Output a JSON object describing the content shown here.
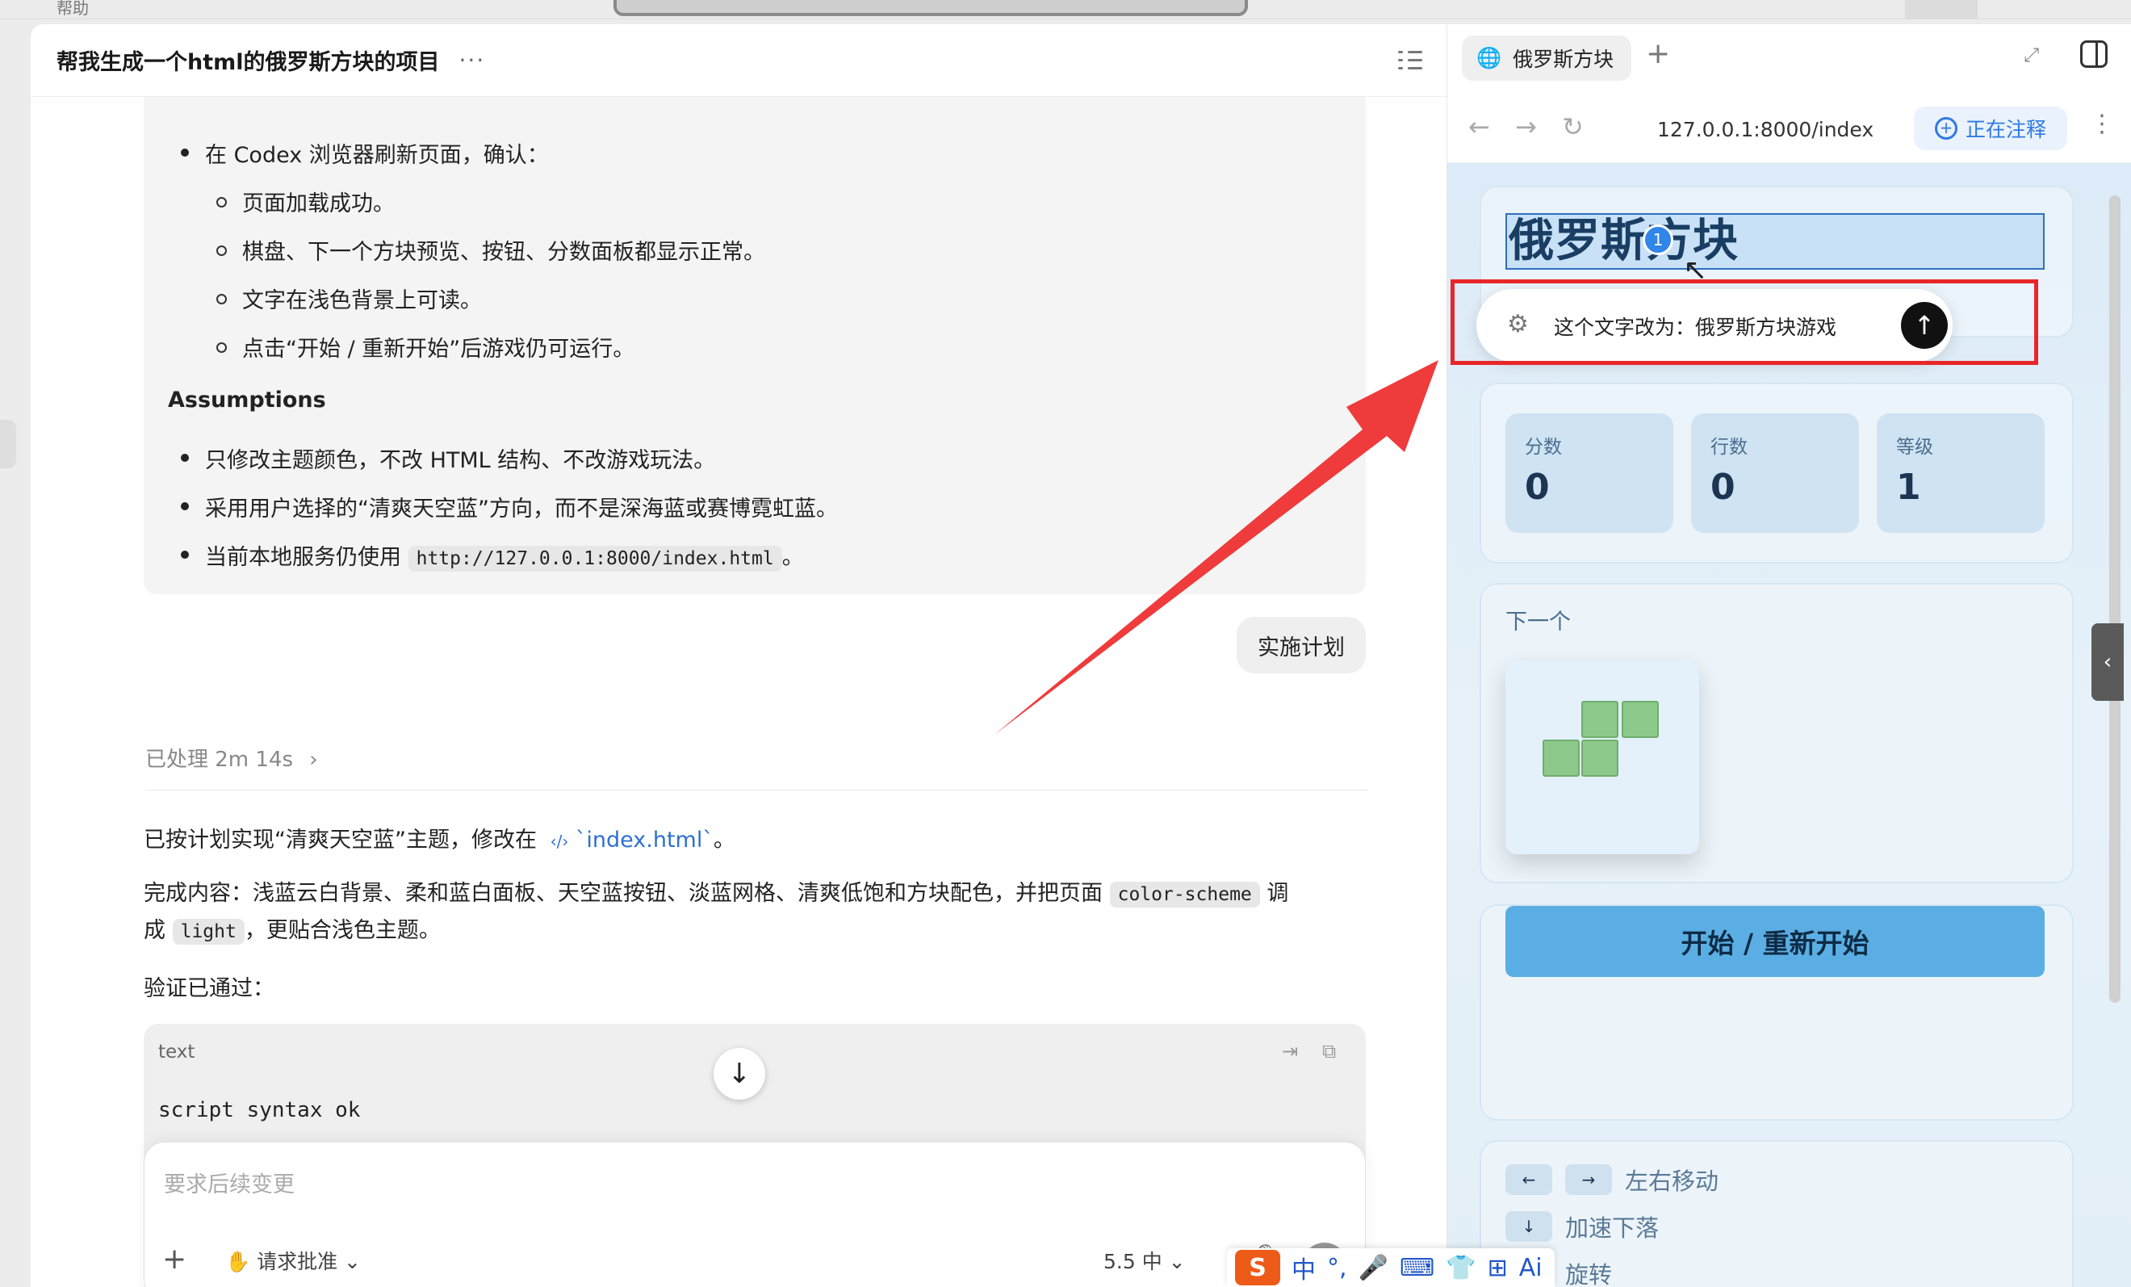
{
  "top": {
    "label": "帮助"
  },
  "chat": {
    "title": "帮我生成一个html的俄罗斯方块的项目",
    "more": "···",
    "plan": {
      "b1": "在 Codex 浏览器刷新页面，确认：",
      "sub": [
        "页面加载成功。",
        "棋盘、下一个方块预览、按钮、分数面板都显示正常。",
        "文字在浅色背景上可读。",
        "点击“开始 / 重新开始”后游戏仍可运行。"
      ],
      "assumptions_title": "Assumptions",
      "a1": "只修改主题颜色，不改 HTML 结构、不改游戏玩法。",
      "a2": "采用用户选择的“清爽天空蓝”方向，而不是深海蓝或赛博霓虹蓝。",
      "a3_prefix": "当前本地服务仍使用",
      "a3_code": "http://127.0.0.1:8000/index.html",
      "a3_suffix": "。"
    },
    "exec_label": "实施计划",
    "processed": "已处理 2m 14s",
    "result_prefix": "已按计划实现“清爽天空蓝”主题，修改在",
    "result_link": "`index.html`",
    "result_suffix": "。",
    "done_prefix": "完成内容：浅蓝云白背景、柔和蓝白面板、天空蓝按钮、淡蓝网格、清爽低饱和方块配色，并把页面",
    "done_code1": "color-scheme",
    "done_mid": "调",
    "done_line2_prefix": "成",
    "done_code2": "light",
    "done_line2_suffix": "，更贴合浅色主题。",
    "verified": "验证已通过：",
    "code_lang": "text",
    "code_text": "script syntax ok",
    "composer": {
      "placeholder": "要求后续变更",
      "approve": "请求批准",
      "model": "5.5 中"
    }
  },
  "browser": {
    "tab_label": "俄罗斯方块",
    "url": "127.0.0.1:8000/index",
    "annotate_label": "正在注释",
    "game": {
      "title": "俄罗斯方块",
      "badge": "1",
      "popup_text": "这个文字改为：俄罗斯方块游戏",
      "stats": [
        {
          "label": "分数",
          "value": "0"
        },
        {
          "label": "行数",
          "value": "0"
        },
        {
          "label": "等级",
          "value": "1"
        }
      ],
      "next_label": "下一个",
      "start_label": "开始 / 重新开始",
      "controls": [
        {
          "keys": [
            "←",
            "→"
          ],
          "label": "左右移动"
        },
        {
          "keys": [
            "↓"
          ],
          "label": "加速下落"
        },
        {
          "keys": [
            "↑"
          ],
          "label": "旋转"
        }
      ]
    }
  },
  "ime": {
    "items": [
      "S",
      "中",
      "°,",
      "🎤",
      "⌨",
      "👕",
      "⊞",
      "Ai"
    ]
  },
  "colors": {
    "accent": "#5aaee4",
    "annotation_red": "#e8262a",
    "link": "#2f6fd1"
  }
}
